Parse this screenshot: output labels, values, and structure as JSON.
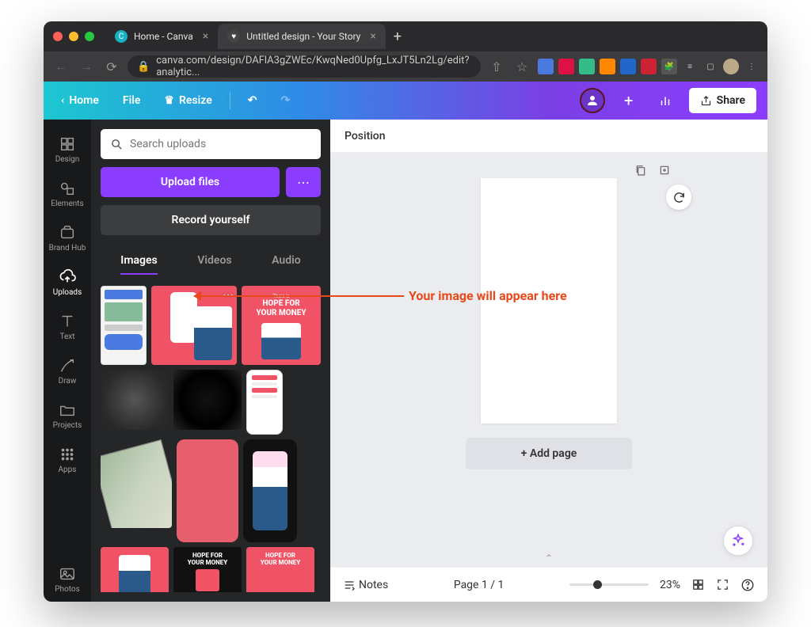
{
  "browser": {
    "tabs": [
      {
        "title": "Home - Canva",
        "favicon": "C"
      },
      {
        "title": "Untitled design - Your Story",
        "favicon": "♥"
      }
    ],
    "url": "canva.com/design/DAFlA3gZWEc/KwqNed0Upfg_LxJT5Ln2Lg/edit?analytic..."
  },
  "header": {
    "home": "Home",
    "file": "File",
    "resize": "Resize",
    "share": "Share"
  },
  "rail": {
    "design": "Design",
    "elements": "Elements",
    "brandhub": "Brand Hub",
    "uploads": "Uploads",
    "text": "Text",
    "draw": "Draw",
    "projects": "Projects",
    "apps": "Apps",
    "photos": "Photos"
  },
  "panel": {
    "search_placeholder": "Search uploads",
    "upload_files": "Upload files",
    "record_yourself": "Record yourself",
    "tabs": {
      "images": "Images",
      "videos": "Videos",
      "audio": "Audio"
    }
  },
  "position_bar": "Position",
  "add_page": "+ Add page",
  "footer": {
    "notes": "Notes",
    "page_indicator": "Page 1 / 1",
    "zoom": "23%"
  },
  "annotation": "Your image will appear here",
  "thumbnails": {
    "hope_text_1": "HOPE FOR",
    "hope_text_2": "YOUR MONEY",
    "there_is": "There is"
  }
}
